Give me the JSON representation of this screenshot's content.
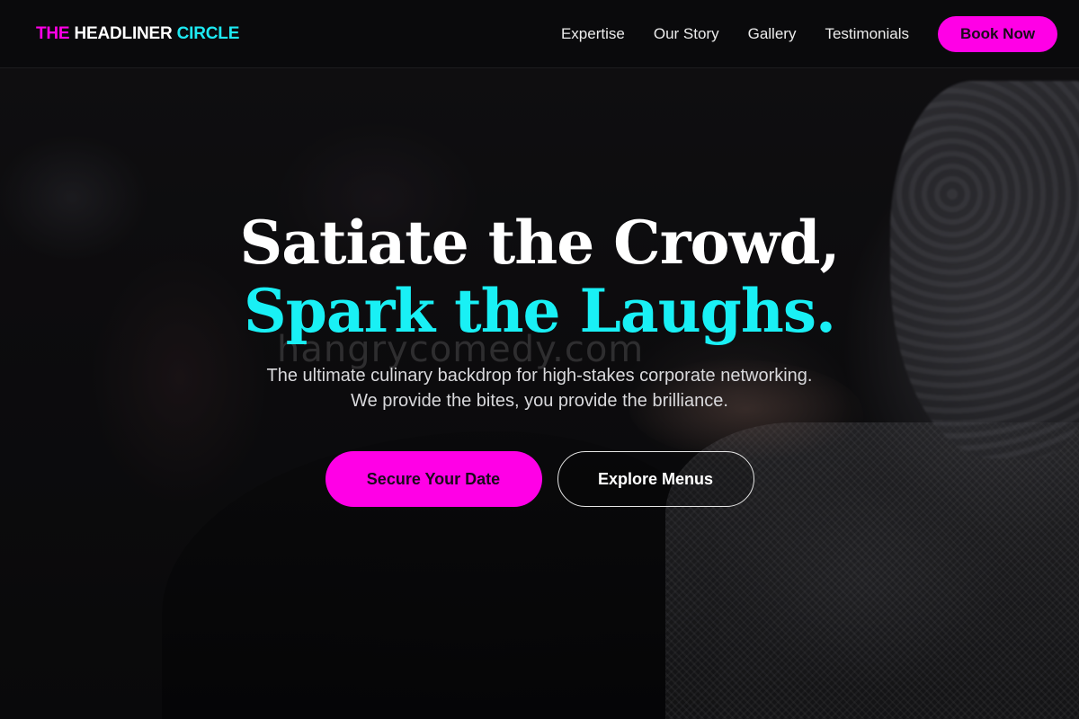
{
  "brand": {
    "part1": "THE",
    "part2": "HEADLINER",
    "part3": "CIRCLE",
    "colors": {
      "accent_magenta": "#ff00e6",
      "accent_cyan": "#19f0f5",
      "background": "#0b0b0d"
    }
  },
  "nav": {
    "links": [
      "Expertise",
      "Our Story",
      "Gallery",
      "Testimonials"
    ],
    "cta_label": "Book Now"
  },
  "hero": {
    "headline_line1": "Satiate the Crowd,",
    "headline_line2": "Spark the Laughs.",
    "watermark": "hangrycomedy.com",
    "subtitle": "The ultimate culinary backdrop for high-stakes corporate networking. We provide the bites, you provide the brilliance.",
    "primary_cta": "Secure Your Date",
    "secondary_cta": "Explore Menus"
  }
}
